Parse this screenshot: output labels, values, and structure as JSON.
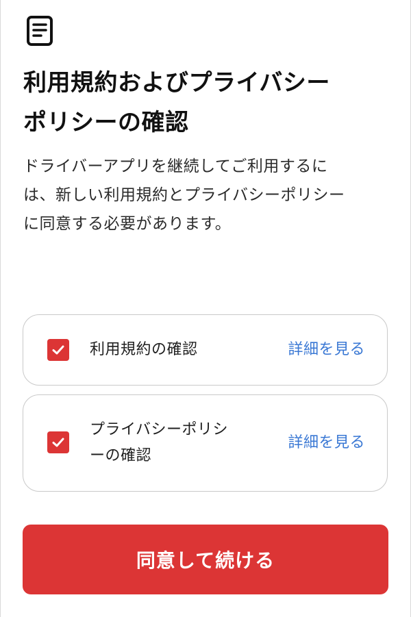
{
  "header": {
    "icon": "document-icon",
    "title_line1": "利用規約およびプライバシー",
    "title_line2": "ポリシーの確認"
  },
  "intro": {
    "line1": "ドライバーアプリを継続してご利用するに",
    "line2": "は、新しい利用規約とプライバシーポリシー",
    "line3": "に同意する必要があります。"
  },
  "consents": [
    {
      "label_line1": "利用規約の確認",
      "label_line2": "",
      "checked": true,
      "link_label": "詳細を見る"
    },
    {
      "label_line1": "プライバシーポリシ",
      "label_line2": "ーの確認",
      "checked": true,
      "link_label": "詳細を見る"
    }
  ],
  "footer": {
    "agree_button_label": "同意して続ける"
  },
  "colors": {
    "accent": "#dc3535",
    "link": "#3a78d4",
    "border": "#c9c9c9",
    "text": "#111111"
  }
}
